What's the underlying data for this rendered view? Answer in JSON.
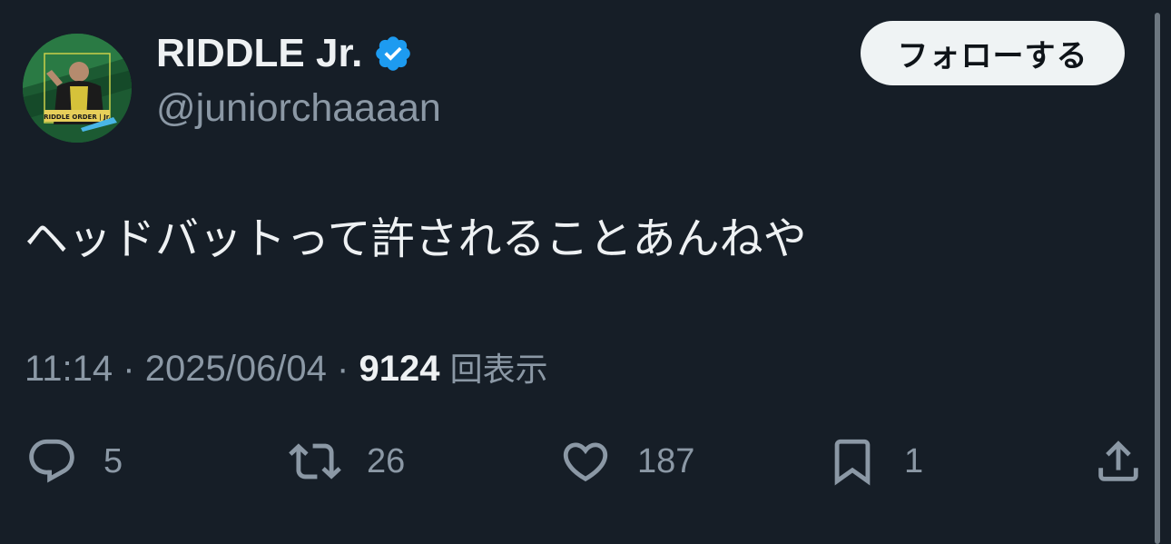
{
  "user": {
    "display_name": "RIDDLE Jr.",
    "handle": "@juniorchaaaan",
    "verified": true,
    "avatar_banner_text": "RIDDLE ORDER | Jr."
  },
  "follow_button": {
    "label": "フォローする"
  },
  "tweet": {
    "text": "ヘッドバットって許されることあんねや",
    "time": "11:14",
    "separator": "·",
    "date": "2025/06/04",
    "views_count": "9124",
    "views_label": "回表示"
  },
  "actions": {
    "reply": {
      "icon": "reply-icon",
      "count": "5"
    },
    "retweet": {
      "icon": "retweet-icon",
      "count": "26"
    },
    "like": {
      "icon": "heart-icon",
      "count": "187"
    },
    "bookmark": {
      "icon": "bookmark-icon",
      "count": "1"
    },
    "share": {
      "icon": "share-icon"
    }
  },
  "colors": {
    "background": "#161e27",
    "primary_text": "#eef1f3",
    "secondary_text": "#8b98a5",
    "verified_badge": "#1d9bf0",
    "follow_button_bg": "#eff3f4"
  }
}
